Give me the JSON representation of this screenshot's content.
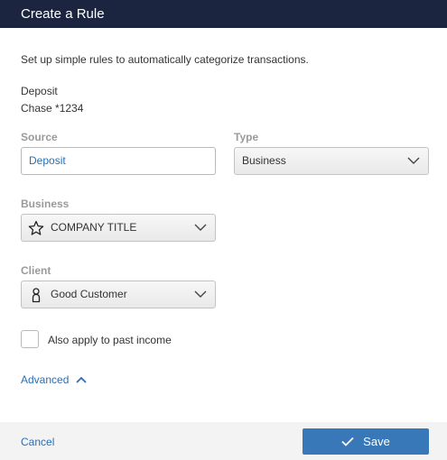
{
  "dialog": {
    "title": "Create a Rule"
  },
  "intro": "Set up simple rules to automatically categorize transactions.",
  "transaction": {
    "name": "Deposit",
    "account": "Chase *1234"
  },
  "source": {
    "label": "Source",
    "value": "Deposit"
  },
  "type": {
    "label": "Type",
    "value": "Business"
  },
  "business": {
    "label": "Business",
    "value": "COMPANY TITLE",
    "icon": "star-icon"
  },
  "client": {
    "label": "Client",
    "value": "Good Customer",
    "icon": "person-icon"
  },
  "past_income": {
    "label": "Also apply to past income",
    "checked": false
  },
  "advanced": {
    "label": "Advanced",
    "expanded": true
  },
  "footer": {
    "cancel_label": "Cancel",
    "save_label": "Save"
  },
  "colors": {
    "header_bg": "#1c2540",
    "link": "#2a6fb4",
    "primary_button": "#3878b8",
    "footer_bg": "#f3f3f4",
    "field_label": "#9a9a9a"
  }
}
